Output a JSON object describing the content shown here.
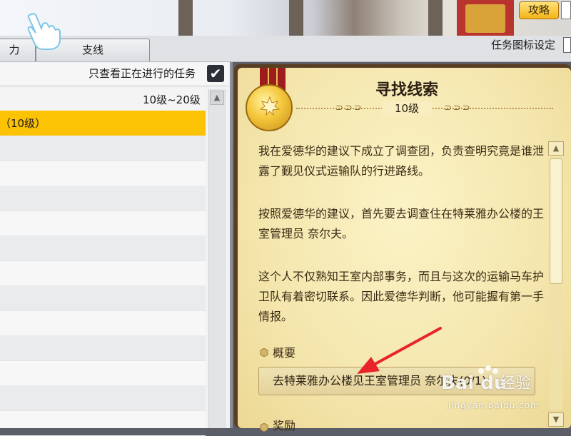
{
  "top": {
    "guide_button": "攻略",
    "tabs": [
      {
        "label": "力"
      },
      {
        "label": "支线"
      }
    ],
    "icon_setting_label": "任务图标设定"
  },
  "left_panel": {
    "filter_label": "只查看正在进行的任务",
    "filter_checked": true,
    "level_range_header": "10级~20级",
    "selected_row": "（10级）"
  },
  "quest": {
    "title": "寻找线索",
    "level": "10级",
    "paragraphs": [
      "我在爱德华的建议下成立了调查团，负责查明究竟是谁泄露了觐见仪式运输队的行进路线。",
      "按照爱德华的建议，首先要去调查住在特莱雅办公楼的王室管理员 奈尔夫。",
      "这个人不仅熟知王室内部事务，而且与这次的运输马车护卫队有着密切联系。因此爱德华判断，他可能握有第一手情报。"
    ],
    "summary_label": "概要",
    "summary_text": "去特莱雅办公楼见王室管理员 奈尔夫(0/1)",
    "reward_label": "奖励"
  },
  "watermark": {
    "brand": "Bai du",
    "suffix": "经验",
    "url": "jingyan.baidu.com"
  },
  "colors": {
    "selected_row": "#fcc204",
    "guide_button": "#f3b417",
    "parchment": "#f4e6ad",
    "annotation_arrow": "#e8242a"
  }
}
